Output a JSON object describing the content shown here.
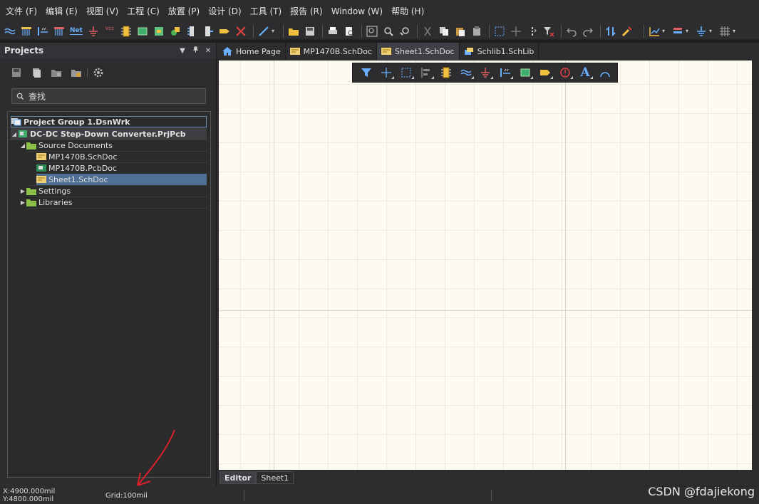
{
  "menu": [
    "文件 (F)",
    "编辑 (E)",
    "视图 (V)",
    "工程 (C)",
    "放置 (P)",
    "设计 (D)",
    "工具 (T)",
    "报告 (R)",
    "Window (W)",
    "帮助 (H)"
  ],
  "toolbar": {
    "icons": [
      "wire-icon",
      "bus-icon",
      "bus-entry-icon",
      "harness-icon",
      "net-label-icon",
      "gnd-port-icon",
      "vcc-port-icon",
      "part-icon",
      "sheet-symbol-icon",
      "sheet-entry-icon",
      "device-sheet-icon",
      "harness-connector-icon",
      "harness-entry-icon",
      "port-icon",
      "no-erc-icon",
      "line-icon",
      "open-icon",
      "save-icon",
      "print-icon",
      "print-preview-icon",
      "zoom-fit-icon",
      "zoom-area-icon",
      "zoom-selected-icon",
      "cut-icon",
      "copy-icon",
      "paste-icon",
      "rubber-stamp-icon",
      "select-area-icon",
      "move-icon",
      "select-toggle-icon",
      "clear-filter-icon",
      "undo-icon",
      "redo-icon",
      "hierarchy-icon",
      "cross-probe-icon",
      "align-icon",
      "layer-icon",
      "grid-icon"
    ],
    "net_label": "Net",
    "vcc_label": "Vcc"
  },
  "projects_panel": {
    "title": "Projects",
    "pin_glyph": "▼ 📌 ✕",
    "search_placeholder": "查找",
    "tree": {
      "group": "Project Group 1.DsnWrk",
      "project": "DC-DC Step-Down Converter.PrjPcb",
      "source_documents": "Source Documents",
      "docs": [
        "MP1470B.SchDoc",
        "MP1470B.PcbDoc",
        "Sheet1.SchDoc"
      ],
      "settings": "Settings",
      "libraries": "Libraries"
    }
  },
  "doc_tabs": [
    "Home Page",
    "MP1470B.SchDoc",
    "Sheet1.SchDoc",
    "Schlib1.SchLib"
  ],
  "active_doc_tab": "Sheet1.SchDoc",
  "bottom_tabs": [
    "Editor",
    "Sheet1"
  ],
  "status": {
    "coords": "X:4900.000mil Y:4800.000mil",
    "grid": "Grid:100mil"
  },
  "watermark": "CSDN @fdajiekong",
  "colors": {
    "canvas": "#fdfaf2",
    "selection": "#4f6f94",
    "dark_bg": "#2d2d30",
    "annotation": "#d8202a"
  }
}
